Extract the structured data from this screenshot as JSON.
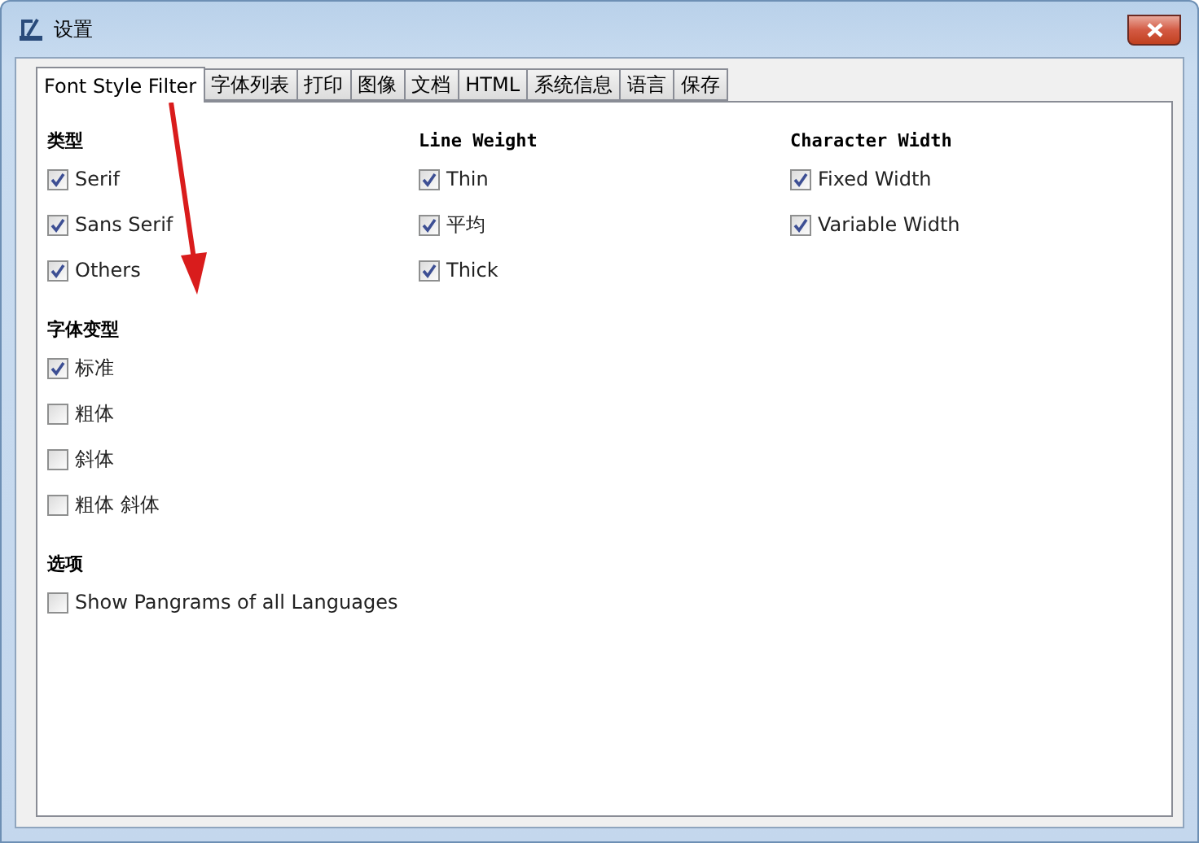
{
  "window": {
    "title": "设置"
  },
  "tabs": [
    {
      "label": "Font Style Filter",
      "selected": true
    },
    {
      "label": "字体列表",
      "selected": false
    },
    {
      "label": "打印",
      "selected": false
    },
    {
      "label": "图像",
      "selected": false
    },
    {
      "label": "文档",
      "selected": false
    },
    {
      "label": "HTML",
      "selected": false
    },
    {
      "label": "系统信息",
      "selected": false
    },
    {
      "label": "语言",
      "selected": false
    },
    {
      "label": "保存",
      "selected": false
    }
  ],
  "top_groups": [
    {
      "title": "类型",
      "options": [
        {
          "label": "Serif",
          "checked": true
        },
        {
          "label": "Sans Serif",
          "checked": true
        },
        {
          "label": "Others",
          "checked": true
        }
      ]
    },
    {
      "title": "Line Weight",
      "options": [
        {
          "label": "Thin",
          "checked": true
        },
        {
          "label": "平均",
          "checked": true
        },
        {
          "label": "Thick",
          "checked": true
        }
      ]
    },
    {
      "title": "Character Width",
      "options": [
        {
          "label": "Fixed Width",
          "checked": true
        },
        {
          "label": "Variable Width",
          "checked": true
        }
      ]
    }
  ],
  "groups": [
    {
      "title": "字体变型",
      "options": [
        {
          "label": "标准",
          "checked": true
        },
        {
          "label": "粗体",
          "checked": false
        },
        {
          "label": "斜体",
          "checked": false
        },
        {
          "label": "粗体 斜体",
          "checked": false
        }
      ]
    },
    {
      "title": "选项",
      "options": [
        {
          "label": "Show Pangrams of all Languages",
          "checked": false
        }
      ]
    }
  ]
}
